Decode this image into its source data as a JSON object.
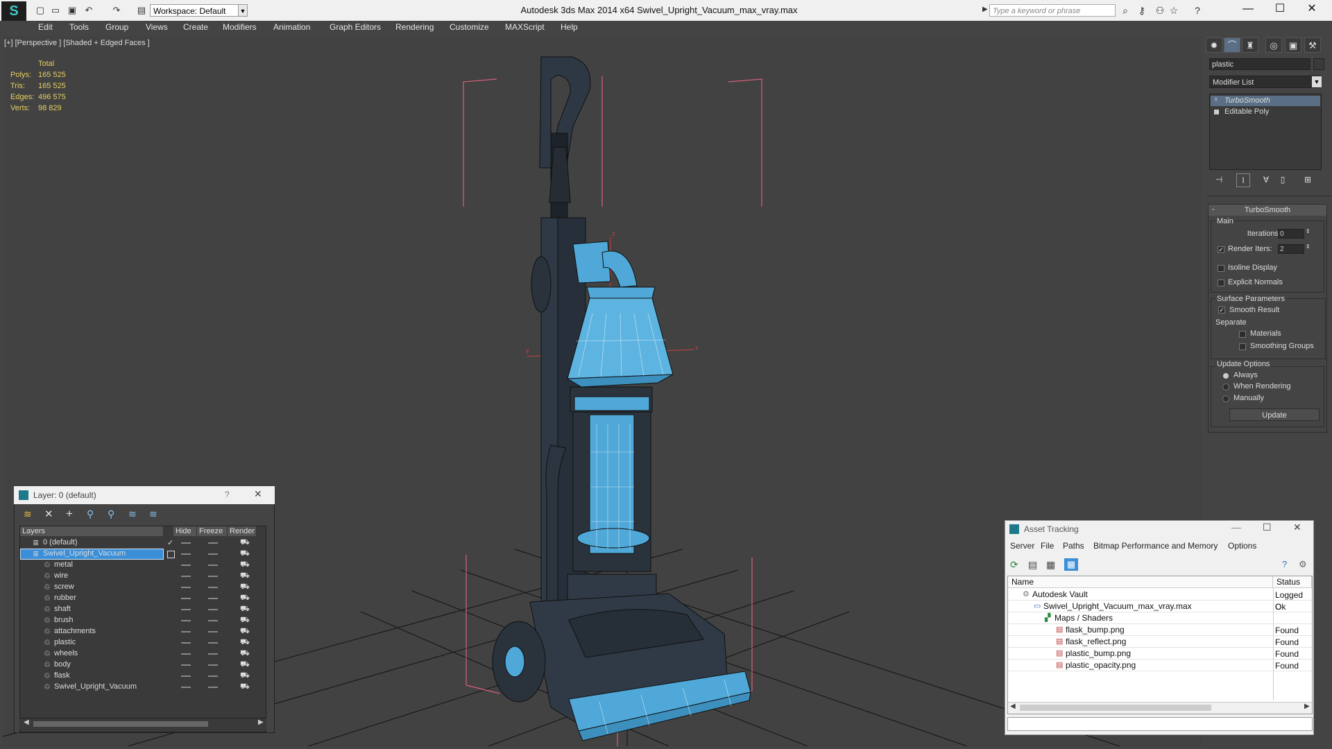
{
  "app": {
    "title": "Autodesk 3ds Max  2014 x64      Swivel_Upright_Vacuum_max_vray.max",
    "workspace": "Workspace: Default",
    "search_placeholder": "Type a keyword or phrase"
  },
  "menu": [
    "Edit",
    "Tools",
    "Group",
    "Views",
    "Create",
    "Modifiers",
    "Animation",
    "Graph Editors",
    "Rendering",
    "Customize",
    "MAXScript",
    "Help"
  ],
  "viewport": {
    "label": "[+] [Perspective ] [Shaded + Edged Faces ]",
    "stats": {
      "header": "Total",
      "rows": [
        {
          "label": "Polys:",
          "value": "165 525"
        },
        {
          "label": "Tris:",
          "value": "165 525"
        },
        {
          "label": "Edges:",
          "value": "496 575"
        },
        {
          "label": "Verts:",
          "value": "98 829"
        }
      ]
    },
    "axis_labels": {
      "y": "y",
      "x": "x",
      "z": "z"
    }
  },
  "command_panel": {
    "object_name": "plastic",
    "modifier_list": "Modifier List",
    "stack": [
      "TurboSmooth",
      "Editable Poly"
    ],
    "turbosmooth": {
      "title": "TurboSmooth",
      "main_label": "Main",
      "iterations_label": "Iterations:",
      "iterations_value": "0",
      "render_iters_label": "Render Iters:",
      "render_iters_value": "2",
      "render_iters_checked": true,
      "isoline_label": "Isoline Display",
      "explicit_normals_label": "Explicit Normals",
      "surface_label": "Surface Parameters",
      "smooth_result_label": "Smooth Result",
      "separate_label": "Separate",
      "materials_label": "Materials",
      "smoothing_groups_label": "Smoothing Groups",
      "update_options_label": "Update Options",
      "always_label": "Always",
      "when_rendering_label": "When Rendering",
      "manually_label": "Manually",
      "update_button": "Update"
    }
  },
  "layer_dialog": {
    "title": "Layer: 0 (default)",
    "help": "?",
    "columns": [
      "Layers",
      "Hide",
      "Freeze",
      "Render"
    ],
    "layers": [
      {
        "name": "0 (default)",
        "level": 0,
        "selected": false
      },
      {
        "name": "Swivel_Upright_Vacuum",
        "level": 0,
        "selected": true
      },
      {
        "name": "metal",
        "level": 1,
        "selected": false
      },
      {
        "name": "wire",
        "level": 1,
        "selected": false
      },
      {
        "name": "screw",
        "level": 1,
        "selected": false
      },
      {
        "name": "rubber",
        "level": 1,
        "selected": false
      },
      {
        "name": "shaft",
        "level": 1,
        "selected": false
      },
      {
        "name": "brush",
        "level": 1,
        "selected": false
      },
      {
        "name": "attachments",
        "level": 1,
        "selected": false
      },
      {
        "name": "plastic",
        "level": 1,
        "selected": false
      },
      {
        "name": "wheels",
        "level": 1,
        "selected": false
      },
      {
        "name": "body",
        "level": 1,
        "selected": false
      },
      {
        "name": "flask",
        "level": 1,
        "selected": false
      },
      {
        "name": "Swivel_Upright_Vacuum",
        "level": 1,
        "selected": false
      }
    ]
  },
  "asset_tracking": {
    "title": "Asset Tracking",
    "menu": [
      "Server",
      "File",
      "Paths",
      "Bitmap Performance and Memory",
      "Options"
    ],
    "columns": [
      "Name",
      "Status"
    ],
    "rows": [
      {
        "name": "Autodesk Vault",
        "status": "Logged O",
        "indent": 1
      },
      {
        "name": "Swivel_Upright_Vacuum_max_vray.max",
        "status": "Ok",
        "indent": 2
      },
      {
        "name": "Maps / Shaders",
        "status": "",
        "indent": 3
      },
      {
        "name": "flask_bump.png",
        "status": "Found",
        "indent": 4
      },
      {
        "name": "flask_reflect.png",
        "status": "Found",
        "indent": 4
      },
      {
        "name": "plastic_bump.png",
        "status": "Found",
        "indent": 4
      },
      {
        "name": "plastic_opacity.png",
        "status": "Found",
        "indent": 4
      }
    ]
  },
  "colors": {
    "viewport_bg": "#424242",
    "selection_blue": "#3a8fd8",
    "mesh_blue": "#4fa8d8",
    "bbox_pink": "#d8607a",
    "stats_yellow": "#e6d060"
  }
}
